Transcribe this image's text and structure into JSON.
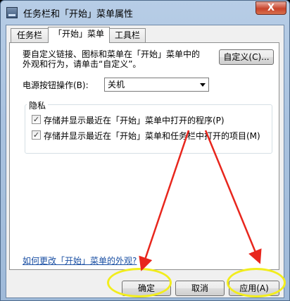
{
  "window": {
    "title": "任务栏和「开始」菜单属性",
    "close_glyph": "X"
  },
  "tabs": [
    {
      "label": "任务栏"
    },
    {
      "label": "「开始」菜单"
    },
    {
      "label": "工具栏"
    }
  ],
  "customize": {
    "description_line1": "要自定义链接、图标和菜单在「开始」菜单中的",
    "description_line2": "外观和行为，请单击“自定义”。",
    "button_label": "自定义(C)..."
  },
  "power": {
    "label": "电源按钮操作(B):",
    "selected": "关机"
  },
  "privacy": {
    "group_title": "隐私",
    "items": [
      {
        "label": "存储并显示最近在「开始」菜单中打开的程序(P)",
        "checked": true
      },
      {
        "label": "存储并显示最近在「开始」菜单和任务栏中打开的项目(M)",
        "checked": true
      }
    ]
  },
  "help_link": "如何更改「开始」菜单的外观?",
  "buttons": {
    "ok": "确定",
    "cancel": "取消",
    "apply": "应用(A)"
  },
  "annotation": {
    "ellipse_color": "#f2ed1d",
    "arrow_color": "#e8261d"
  }
}
